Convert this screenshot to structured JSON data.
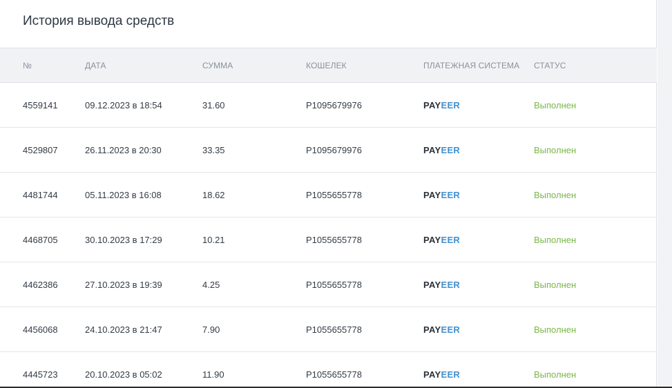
{
  "page": {
    "title": "История вывода средств"
  },
  "colors": {
    "status_success": "#7ab648",
    "payeer_dark": "#2b3138",
    "payeer_blue": "#3f8fd1",
    "header_bg": "#f1f2f4"
  },
  "table": {
    "columns": [
      "№",
      "Дата",
      "Сумма",
      "Кошелек",
      "Платежная система",
      "Статус"
    ],
    "rows": [
      {
        "num": "4559141",
        "date": "09.12.2023 в 18:54",
        "sum": "31.60",
        "wallet": "P1095679976",
        "system_a": "PAY",
        "system_b": "EER",
        "status": "Выполнен"
      },
      {
        "num": "4529807",
        "date": "26.11.2023 в 20:30",
        "sum": "33.35",
        "wallet": "P1095679976",
        "system_a": "PAY",
        "system_b": "EER",
        "status": "Выполнен"
      },
      {
        "num": "4481744",
        "date": "05.11.2023 в 16:08",
        "sum": "18.62",
        "wallet": "P1055655778",
        "system_a": "PAY",
        "system_b": "EER",
        "status": "Выполнен"
      },
      {
        "num": "4468705",
        "date": "30.10.2023 в 17:29",
        "sum": "10.21",
        "wallet": "P1055655778",
        "system_a": "PAY",
        "system_b": "EER",
        "status": "Выполнен"
      },
      {
        "num": "4462386",
        "date": "27.10.2023 в 19:39",
        "sum": "4.25",
        "wallet": "P1055655778",
        "system_a": "PAY",
        "system_b": "EER",
        "status": "Выполнен"
      },
      {
        "num": "4456068",
        "date": "24.10.2023 в 21:47",
        "sum": "7.90",
        "wallet": "P1055655778",
        "system_a": "PAY",
        "system_b": "EER",
        "status": "Выполнен"
      },
      {
        "num": "4445723",
        "date": "20.10.2023 в 05:02",
        "sum": "11.90",
        "wallet": "P1055655778",
        "system_a": "PAY",
        "system_b": "EER",
        "status": "Выполнен"
      }
    ]
  }
}
